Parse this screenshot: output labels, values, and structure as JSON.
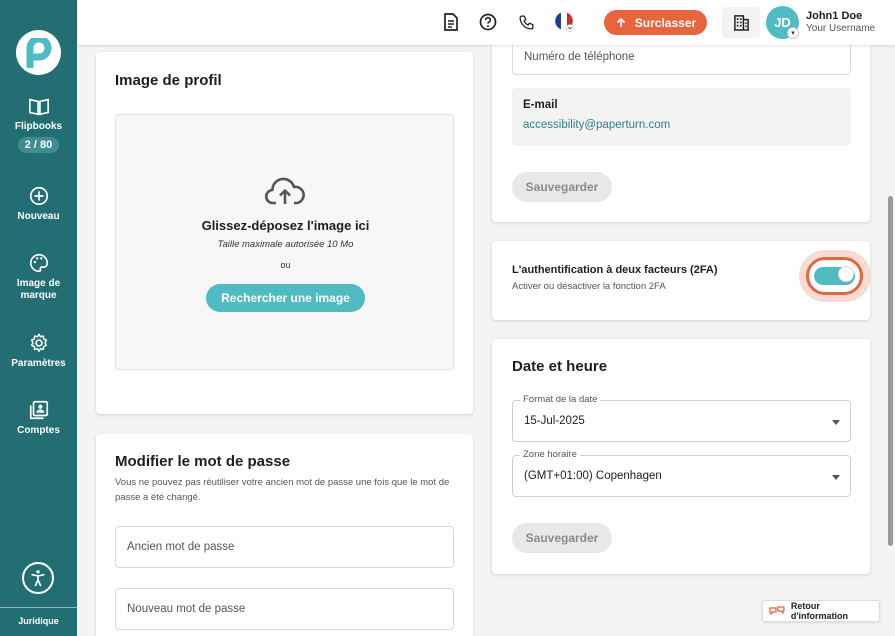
{
  "sidebar": {
    "items": [
      {
        "label": "Flipbooks",
        "icon": "book-open-icon",
        "badge": "2 / 80"
      },
      {
        "label": "Nouveau",
        "icon": "plus-circle-icon"
      },
      {
        "label": "Image de marque",
        "icon": "palette-icon"
      },
      {
        "label": "Paramètres",
        "icon": "gear-icon"
      },
      {
        "label": "Comptes",
        "icon": "accounts-icon"
      }
    ],
    "legal": "Juridique"
  },
  "topbar": {
    "upgrade_label": "Surclasser",
    "user": {
      "initials": "JD",
      "name": "John1 Doe",
      "username": "Your Username"
    }
  },
  "profile_image": {
    "title": "Image de profil",
    "drop_title": "Glissez-déposez l'image ici",
    "max_size": "Taille maximale autorisée 10 Mo",
    "or": "ou",
    "search_button": "Rechercher une image"
  },
  "password": {
    "title": "Modifier le mot de passe",
    "description": "Vous ne pouvez pas réutiliser votre ancien mot de passe une fois que le mot de passe a été changé.",
    "old_placeholder": "Ancien mot de passe",
    "new_placeholder": "Nouveau mot de passe"
  },
  "contact": {
    "phone_placeholder": "Numéro de téléphone",
    "email_label": "E-mail",
    "email_value": "accessibility@paperturn.com",
    "save_label": "Sauvegarder"
  },
  "twofa": {
    "title": "L'authentification à deux facteurs (2FA)",
    "description": "Activer ou désactiver la fonction 2FA",
    "enabled": true
  },
  "datetime": {
    "title": "Date et heure",
    "date_format_label": "Format de la date",
    "date_format_value": "15-Jul-2025",
    "timezone_label": "Zone horaire",
    "timezone_value": "(GMT+01:00) Copenhagen",
    "save_label": "Sauvegarder"
  },
  "feedback_label": "Retour d'information",
  "colors": {
    "sidebar": "#236e73",
    "accent": "#4fbcc3",
    "orange": "#e8643c"
  }
}
